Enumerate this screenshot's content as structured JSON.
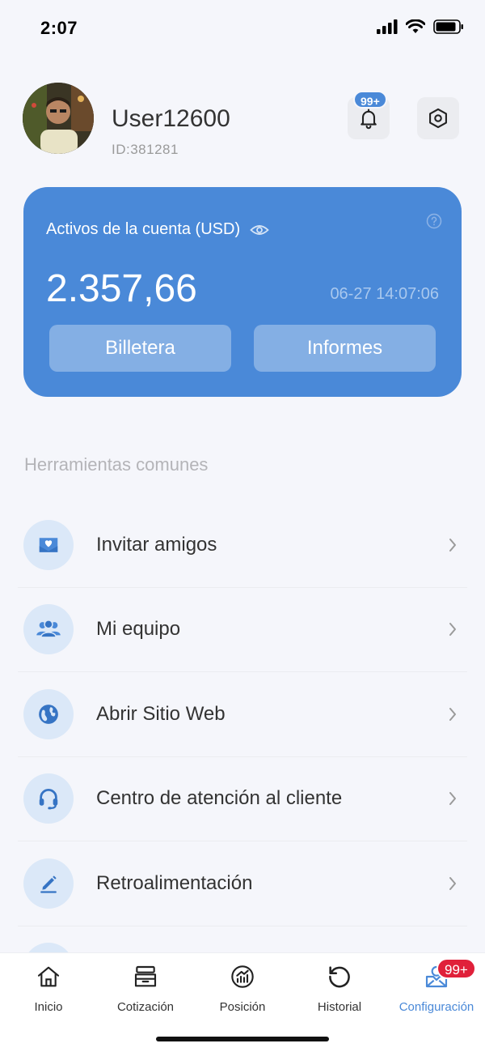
{
  "status_bar": {
    "time": "2:07"
  },
  "profile": {
    "username": "User12600",
    "id_label": "ID:381281",
    "notification_badge": "99+"
  },
  "assets_card": {
    "label": "Activos de la cuenta (USD)",
    "value": "2.357,66",
    "timestamp": "06-27 14:07:06",
    "wallet_label": "Billetera",
    "reports_label": "Informes"
  },
  "tools": {
    "title": "Herramientas comunes",
    "items": [
      {
        "label": "Invitar amigos",
        "icon": "envelope-heart-icon"
      },
      {
        "label": "Mi equipo",
        "icon": "team-icon"
      },
      {
        "label": "Abrir Sitio Web",
        "icon": "globe-icon"
      },
      {
        "label": "Centro de atención al cliente",
        "icon": "headset-icon"
      },
      {
        "label": "Retroalimentación",
        "icon": "pencil-icon"
      }
    ]
  },
  "tab_bar": {
    "tabs": [
      {
        "label": "Inicio",
        "icon": "home-icon",
        "active": false
      },
      {
        "label": "Cotización",
        "icon": "archive-icon",
        "active": false
      },
      {
        "label": "Posición",
        "icon": "chart-circle-icon",
        "active": false
      },
      {
        "label": "Historial",
        "icon": "history-icon",
        "active": false
      },
      {
        "label": "Configuración",
        "icon": "user-inbox-icon",
        "active": true
      }
    ],
    "badge": "99+"
  },
  "colors": {
    "accent": "#4a89d8",
    "background": "#f5f6fb",
    "badge_red": "#e0203a",
    "icon_bg": "#dbe8f8"
  }
}
